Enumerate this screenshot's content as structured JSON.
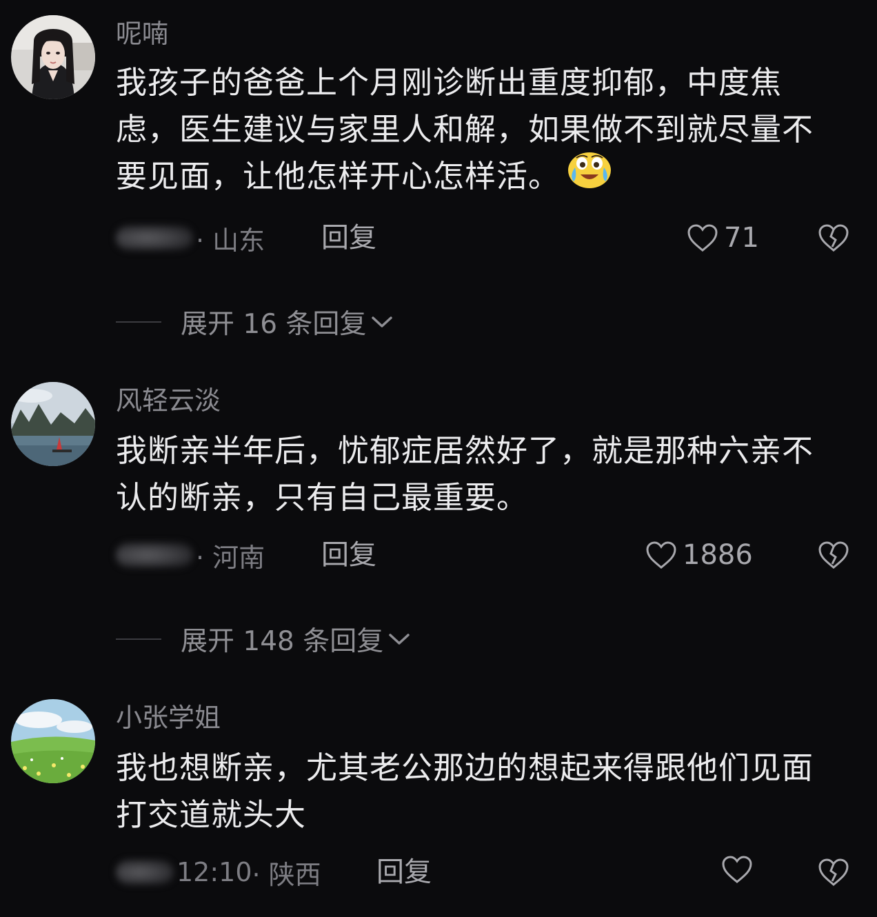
{
  "colors": {
    "background": "#0b0b0d",
    "text": "#ececee",
    "muted": "#7d7d83"
  },
  "comments": [
    {
      "username": "呢喃",
      "text": "我孩子的爸爸上个月刚诊断出重度抑郁，中度焦虑，医生建议与家里人和解，如果做不到就尽量不要见面，让他怎样开心怎样活。",
      "emoji": "crying-laughing-emoji",
      "location": "· 山东",
      "reply_label": "回复",
      "likes": "71",
      "expand_label": "展开 16 条回复"
    },
    {
      "username": "风轻云淡",
      "text": "我断亲半年后，忧郁症居然好了，就是那种六亲不认的断亲，只有自己最重要。",
      "location": "· 河南",
      "reply_label": "回复",
      "likes": "1886",
      "expand_label": "展开 148 条回复"
    },
    {
      "username": "小张学姐",
      "text": "我也想断亲，尤其老公那边的想起来得跟他们见面打交道就头大",
      "time": "12:10",
      "location": "· 陕西",
      "reply_label": "回复",
      "likes": ""
    }
  ]
}
